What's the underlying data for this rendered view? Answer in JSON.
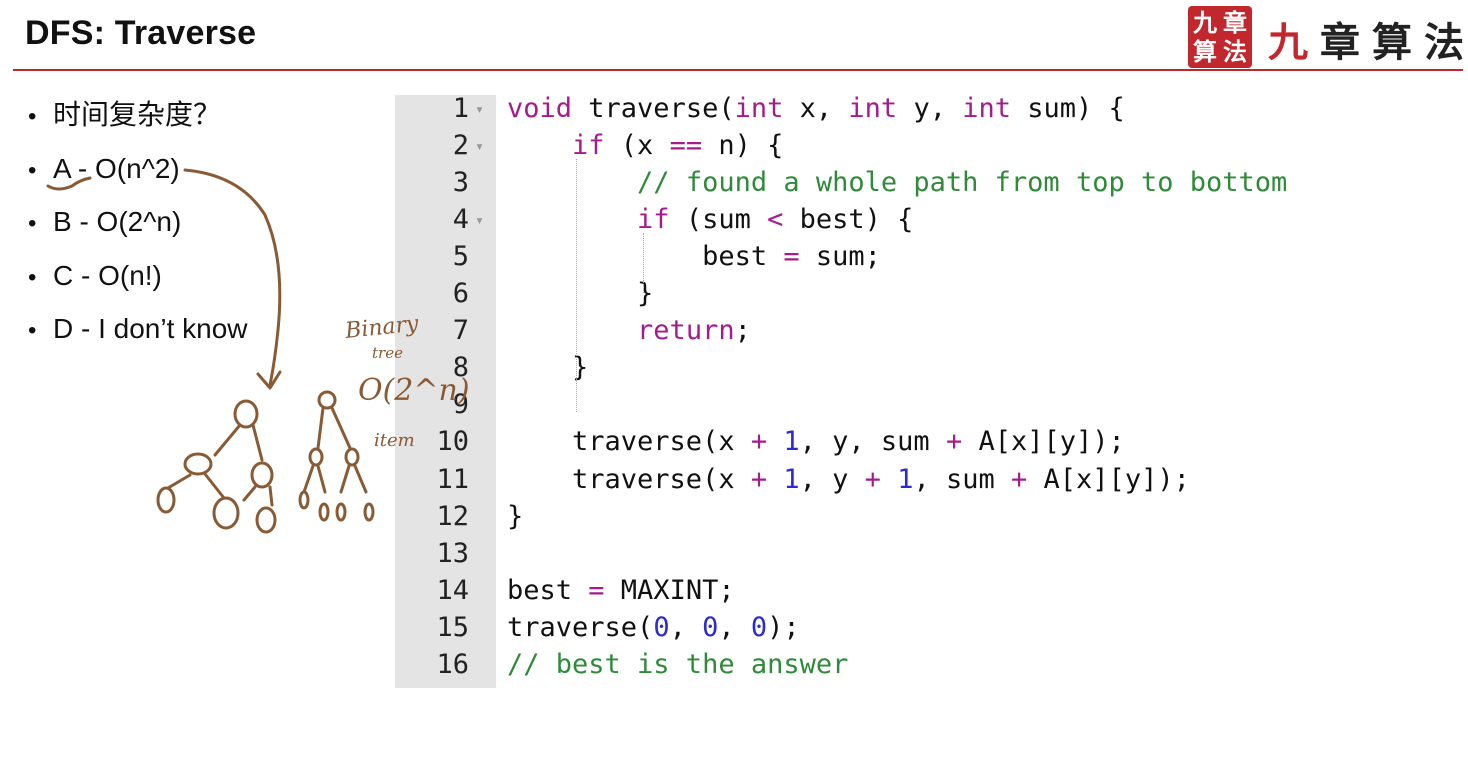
{
  "slide": {
    "title": "DFS: Traverse",
    "accent_color": "#c0272d"
  },
  "logo": {
    "seal_chars": [
      "九",
      "章",
      "算",
      "法"
    ],
    "text_chars": [
      "九",
      "章",
      "算",
      "法"
    ]
  },
  "options": [
    "时间复杂度？",
    "A - O(n^2)",
    "B - O(2^n)",
    "C - O(n!)",
    "D - I don’t know"
  ],
  "code": {
    "line_numbers": [
      "1",
      "2",
      "3",
      "4",
      "5",
      "6",
      "7",
      "8",
      "9",
      "10",
      "11",
      "12",
      "13",
      "14",
      "15",
      "16"
    ],
    "fold_marker": "▾",
    "colors": {
      "keyword": "#a51b8f",
      "number": "#2b2bcf",
      "comment": "#2f8a3a",
      "gutter": "#e4e4e4"
    },
    "lines": [
      [
        {
          "t": "void",
          "c": "kw"
        },
        {
          "t": " traverse("
        },
        {
          "t": "int",
          "c": "kw"
        },
        {
          "t": " x, "
        },
        {
          "t": "int",
          "c": "kw"
        },
        {
          "t": " y, "
        },
        {
          "t": "int",
          "c": "kw"
        },
        {
          "t": " sum) {"
        }
      ],
      [
        {
          "t": "    "
        },
        {
          "t": "if",
          "c": "kw"
        },
        {
          "t": " (x "
        },
        {
          "t": "==",
          "c": "op"
        },
        {
          "t": " n) {"
        }
      ],
      [
        {
          "t": "        "
        },
        {
          "t": "// found a whole path from top to bottom",
          "c": "cm"
        }
      ],
      [
        {
          "t": "        "
        },
        {
          "t": "if",
          "c": "kw"
        },
        {
          "t": " (sum "
        },
        {
          "t": "<",
          "c": "op"
        },
        {
          "t": " best) {"
        }
      ],
      [
        {
          "t": "            best "
        },
        {
          "t": "=",
          "c": "op"
        },
        {
          "t": " sum;"
        }
      ],
      [
        {
          "t": "        }"
        }
      ],
      [
        {
          "t": "        "
        },
        {
          "t": "return",
          "c": "kw"
        },
        {
          "t": ";"
        }
      ],
      [
        {
          "t": "    }"
        }
      ],
      [
        {
          "t": ""
        }
      ],
      [
        {
          "t": "    traverse(x "
        },
        {
          "t": "+",
          "c": "op"
        },
        {
          "t": " "
        },
        {
          "t": "1",
          "c": "num"
        },
        {
          "t": ", y, sum "
        },
        {
          "t": "+",
          "c": "op"
        },
        {
          "t": " A[x][y]);"
        }
      ],
      [
        {
          "t": "    traverse(x "
        },
        {
          "t": "+",
          "c": "op"
        },
        {
          "t": " "
        },
        {
          "t": "1",
          "c": "num"
        },
        {
          "t": ", y "
        },
        {
          "t": "+",
          "c": "op"
        },
        {
          "t": " "
        },
        {
          "t": "1",
          "c": "num"
        },
        {
          "t": ", sum "
        },
        {
          "t": "+",
          "c": "op"
        },
        {
          "t": " A[x][y]);"
        }
      ],
      [
        {
          "t": "}"
        }
      ],
      [
        {
          "t": ""
        }
      ],
      [
        {
          "t": "best "
        },
        {
          "t": "=",
          "c": "op"
        },
        {
          "t": " MAXINT;"
        }
      ],
      [
        {
          "t": "traverse("
        },
        {
          "t": "0",
          "c": "num"
        },
        {
          "t": ", "
        },
        {
          "t": "0",
          "c": "num"
        },
        {
          "t": ", "
        },
        {
          "t": "0",
          "c": "num"
        },
        {
          "t": ");"
        }
      ],
      [
        {
          "t": "// best is the answer",
          "c": "cm"
        }
      ]
    ]
  },
  "handwriting": {
    "ink_color": "#8a5a35",
    "lines": [
      "Binary",
      "tree",
      "O(2^n)",
      "item"
    ]
  }
}
